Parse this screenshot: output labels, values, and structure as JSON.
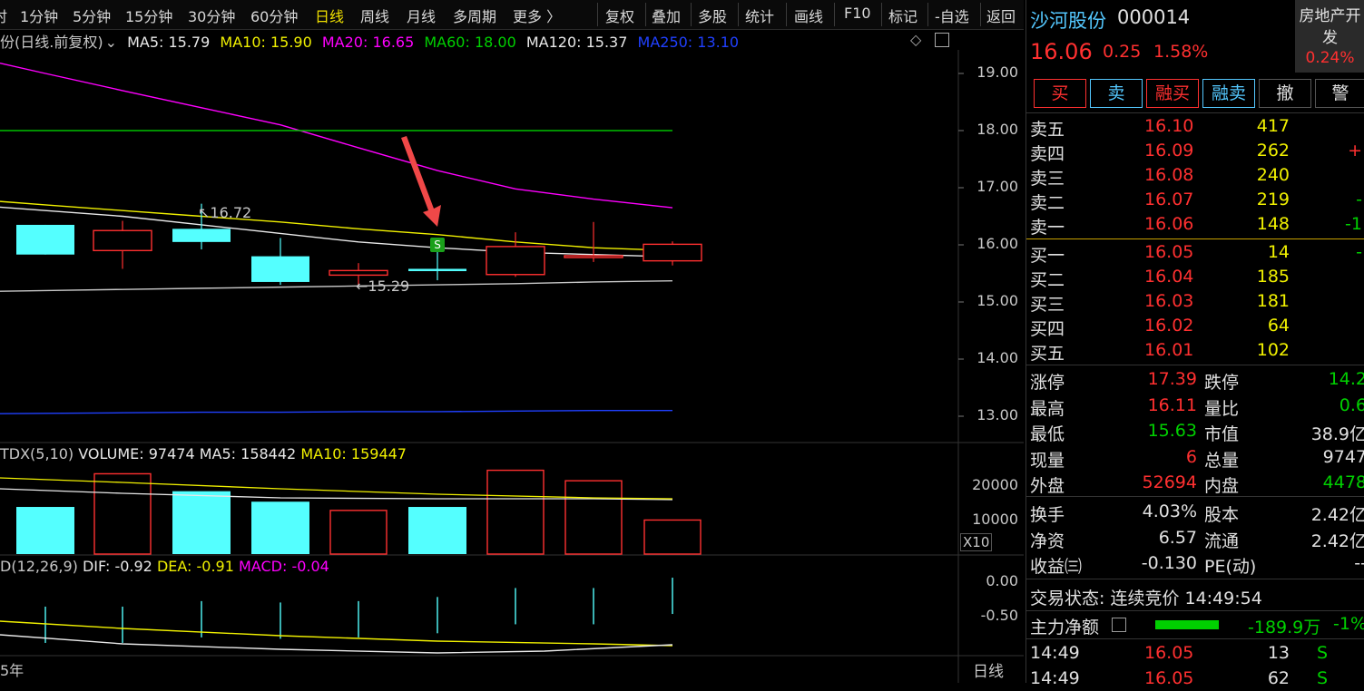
{
  "toolbar": {
    "items": [
      "时",
      "1分钟",
      "5分钟",
      "15分钟",
      "30分钟",
      "60分钟",
      "日线",
      "周线",
      "月线",
      "多周期",
      "更多 〉"
    ],
    "right_items": [
      "复权",
      "叠加",
      "多股",
      "统计",
      "画线",
      "F10",
      "标记",
      "-自选",
      "返回"
    ],
    "active": "日线"
  },
  "main_chart": {
    "title": "份(日线.前复权)",
    "ma5": "MA5: 15.79",
    "ma10": "MA10: 15.90",
    "ma20": "MA20: 16.65",
    "ma60": "MA60: 18.00",
    "ma120": "MA120: 15.37",
    "ma250": "MA250: 13.10",
    "y_ticks": [
      "19.00",
      "18.00",
      "17.00",
      "16.00",
      "15.00",
      "14.00",
      "13.00"
    ],
    "high_marker": "16.72",
    "low_marker": "15.29",
    "signal_badge": "S"
  },
  "volume_chart": {
    "title": "TDX(5,10)",
    "volume": "VOLUME: 97474",
    "ma5": "MA5: 158442",
    "ma10": "MA10: 159447",
    "y_ticks": [
      "20000",
      "10000"
    ],
    "unit": "X10"
  },
  "macd_chart": {
    "title": "D(12,26,9)",
    "dif": "DIF: -0.92",
    "dea": "DEA: -0.91",
    "macd": "MACD: -0.04",
    "y_ticks": [
      "0.00",
      "-0.50"
    ]
  },
  "bottom": {
    "year_label": "5年",
    "period_label": "日线"
  },
  "chart_data": {
    "type": "candlestick",
    "candles": [
      {
        "open": 15.83,
        "close": 16.35,
        "high": 16.35,
        "low": 15.83,
        "color": "cyan"
      },
      {
        "open": 15.9,
        "close": 16.25,
        "high": 16.42,
        "low": 15.58,
        "color": "red"
      },
      {
        "open": 16.28,
        "close": 16.05,
        "high": 16.72,
        "low": 15.92,
        "color": "cyan"
      },
      {
        "open": 15.8,
        "close": 15.35,
        "high": 16.12,
        "low": 15.3,
        "color": "cyan"
      },
      {
        "open": 15.47,
        "close": 15.55,
        "high": 15.68,
        "low": 15.29,
        "color": "red"
      },
      {
        "open": 15.58,
        "close": 15.54,
        "high": 15.9,
        "low": 15.38,
        "color": "cyan"
      },
      {
        "open": 15.48,
        "close": 15.97,
        "high": 16.22,
        "low": 15.44,
        "color": "red"
      },
      {
        "open": 15.79,
        "close": 15.81,
        "high": 16.4,
        "low": 15.7,
        "color": "red"
      },
      {
        "open": 15.72,
        "close": 16.01,
        "high": 16.06,
        "low": 15.64,
        "color": "red"
      }
    ],
    "volumes": [
      13500,
      23000,
      18000,
      15000,
      12500,
      13500,
      24000,
      21000,
      9747
    ],
    "macd_bars": [
      -0.46,
      -0.46,
      -0.38,
      -0.4,
      -0.38,
      -0.32,
      -0.19,
      -0.19,
      -0.04
    ],
    "ma_lines": {
      "MA5": [
        16.6,
        16.5,
        16.35,
        16.2,
        16.05,
        15.95,
        15.87,
        15.83,
        15.79
      ],
      "MA10": [
        16.7,
        16.6,
        16.5,
        16.4,
        16.28,
        16.18,
        16.05,
        15.95,
        15.9
      ],
      "MA20": [
        19.0,
        18.7,
        18.4,
        18.1,
        17.7,
        17.3,
        16.98,
        16.8,
        16.65
      ],
      "MA60": [
        18.0,
        18.0,
        18.0,
        18.0,
        18.0,
        18.0,
        18.0,
        18.0,
        18.0
      ],
      "MA120": [
        15.2,
        15.22,
        15.24,
        15.26,
        15.28,
        15.3,
        15.32,
        15.35,
        15.37
      ],
      "MA250": [
        13.05,
        13.06,
        13.07,
        13.07,
        13.08,
        13.08,
        13.09,
        13.1,
        13.1
      ]
    },
    "ylim": [
      12.6,
      19.4
    ]
  },
  "quote": {
    "name": "沙河股份",
    "code": "000014",
    "sector": "房地产开发",
    "sector_change": "0.24%",
    "price": "16.06",
    "change": "0.25",
    "change_pct": "1.58%",
    "buttons": [
      "买",
      "卖",
      "融买",
      "融卖",
      "撤",
      "警"
    ],
    "asks": [
      {
        "label": "卖五",
        "price": "16.10",
        "vol": "417",
        "extra": ""
      },
      {
        "label": "卖四",
        "price": "16.09",
        "vol": "262",
        "extra": "+"
      },
      {
        "label": "卖三",
        "price": "16.08",
        "vol": "240",
        "extra": ""
      },
      {
        "label": "卖二",
        "price": "16.07",
        "vol": "219",
        "extra": "-"
      },
      {
        "label": "卖一",
        "price": "16.06",
        "vol": "148",
        "extra": "-1"
      }
    ],
    "bids": [
      {
        "label": "买一",
        "price": "16.05",
        "vol": "14",
        "extra": "-"
      },
      {
        "label": "买二",
        "price": "16.04",
        "vol": "185",
        "extra": ""
      },
      {
        "label": "买三",
        "price": "16.03",
        "vol": "181",
        "extra": ""
      },
      {
        "label": "买四",
        "price": "16.02",
        "vol": "64",
        "extra": ""
      },
      {
        "label": "买五",
        "price": "16.01",
        "vol": "102",
        "extra": ""
      }
    ],
    "stats": [
      {
        "l1": "涨停",
        "v1": "17.39",
        "l2": "跌停",
        "v2": "14.2"
      },
      {
        "l1": "最高",
        "v1": "16.11",
        "l2": "量比",
        "v2": "0.6"
      },
      {
        "l1": "最低",
        "v1": "15.63",
        "l2": "市值",
        "v2": "38.9亿"
      },
      {
        "l1": "现量",
        "v1": "6",
        "l2": "总量",
        "v2": "9747"
      },
      {
        "l1": "外盘",
        "v1": "52694",
        "l2": "内盘",
        "v2": "4478"
      }
    ],
    "stats2": [
      {
        "l1": "换手",
        "v1": "4.03%",
        "l2": "股本",
        "v2": "2.42亿"
      },
      {
        "l1": "净资",
        "v1": "6.57",
        "l2": "流通",
        "v2": "2.42亿"
      },
      {
        "l1": "收益㈢",
        "v1": "-0.130",
        "l2": "PE(动)",
        "v2": "--"
      }
    ],
    "status": "交易状态: 连续竞价 14:49:54",
    "main_flow_label": "主力净额",
    "main_flow_value": "-189.9万",
    "main_flow_pct": "-1%",
    "ticks": [
      {
        "time": "14:49",
        "price": "16.05",
        "vol": "13",
        "side": "S"
      },
      {
        "time": "14:49",
        "price": "16.05",
        "vol": "62",
        "side": "S"
      }
    ]
  }
}
